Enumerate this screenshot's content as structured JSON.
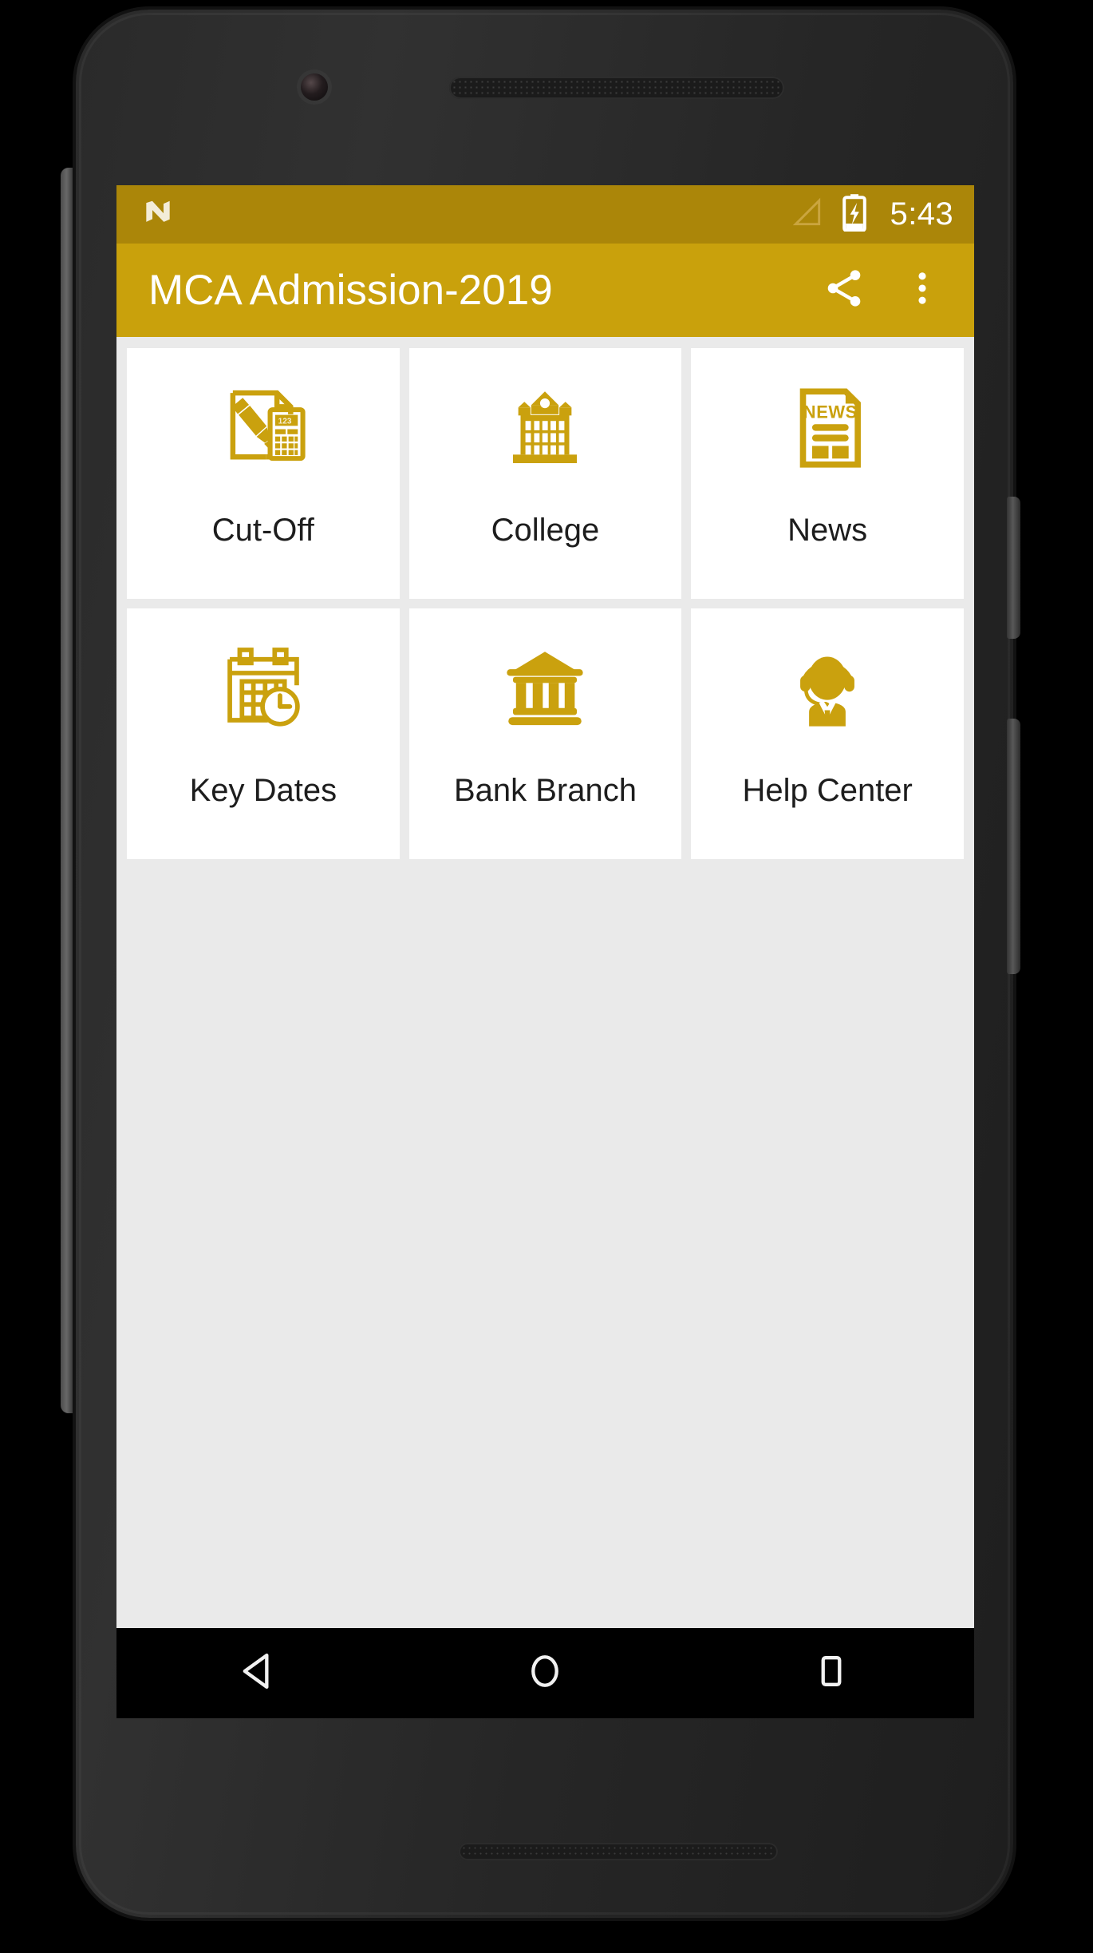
{
  "device": {
    "frame_color": "#2a2a2a",
    "camera_icon": "front-camera",
    "earpiece_icon": "earpiece-speaker"
  },
  "status_bar": {
    "background": "#ab8609",
    "android_logo_icon": "android-nougat-logo-icon",
    "signal_icon": "signal-bars-icon",
    "battery_icon": "battery-charging-icon",
    "time": "5:43"
  },
  "app_bar": {
    "background": "#c9a10c",
    "title": "MCA Admission-2019",
    "actions": [
      {
        "name": "share-button",
        "icon": "share-icon",
        "label": "Share"
      },
      {
        "name": "overflow-menu-button",
        "icon": "more-vert-icon",
        "label": "More options"
      }
    ]
  },
  "main": {
    "background": "#eaeaea",
    "accent": "#c9a10c",
    "tile_background": "#ffffff",
    "tiles": [
      {
        "label": "Cut-Off",
        "icon": "document-pencil-calculator-icon"
      },
      {
        "label": "College",
        "icon": "college-building-icon"
      },
      {
        "label": "News",
        "icon": "newspaper-icon"
      },
      {
        "label": "Key Dates",
        "icon": "calendar-clock-icon"
      },
      {
        "label": "Bank Branch",
        "icon": "bank-building-icon"
      },
      {
        "label": "Help Center",
        "icon": "support-agent-headset-icon"
      }
    ]
  },
  "nav_bar": {
    "background": "#000000",
    "buttons": [
      {
        "name": "back-button",
        "icon": "back-triangle-icon",
        "label": "Back"
      },
      {
        "name": "home-button",
        "icon": "home-circle-icon",
        "label": "Home"
      },
      {
        "name": "recents-button",
        "icon": "recents-square-icon",
        "label": "Recents"
      }
    ]
  }
}
